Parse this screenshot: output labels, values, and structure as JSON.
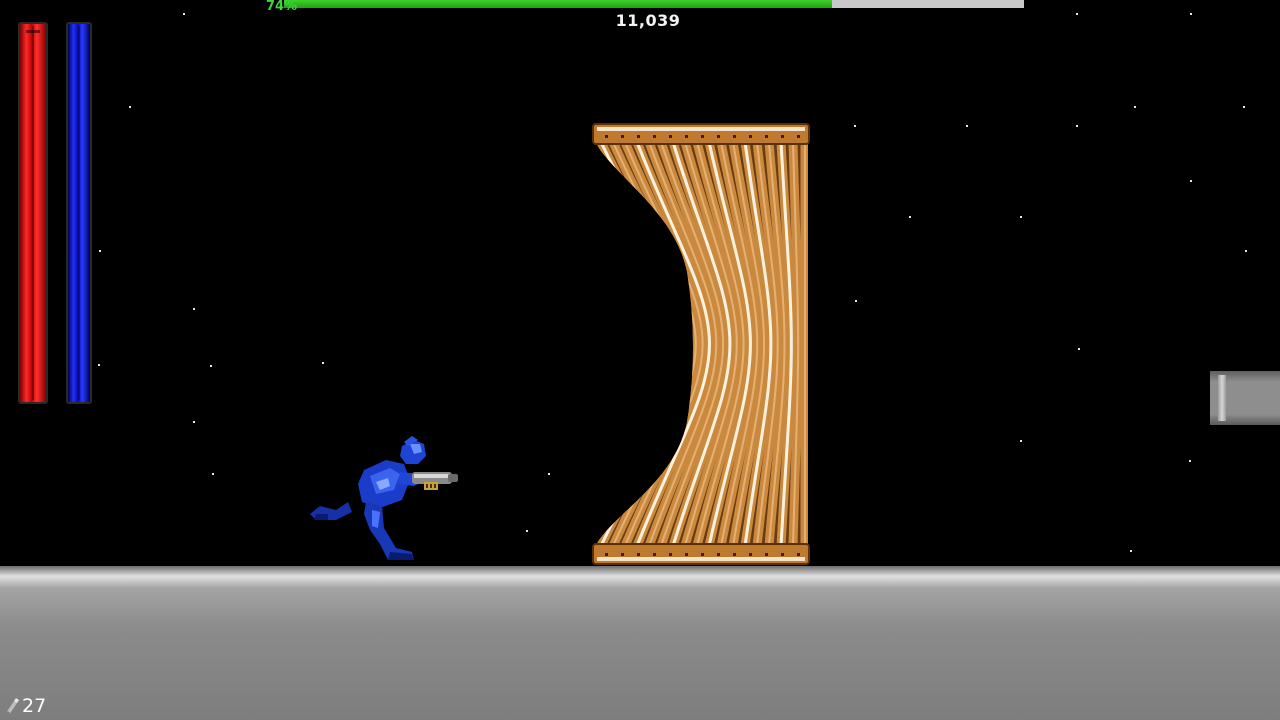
{
  "hud": {
    "progress_label": "74%",
    "progress_value": 0.74,
    "score": "11,039",
    "health_level": 1.0,
    "energy_level": 1.0,
    "ammo_count": "27"
  },
  "colors": {
    "health": "#e01010",
    "energy": "#1a22d8",
    "progress": "#2fbf22",
    "floor": "#8a8a8a",
    "pillar": "#c6863e",
    "hero": "#1a3cc0"
  },
  "icons": {
    "ammo": "bullet-icon"
  }
}
